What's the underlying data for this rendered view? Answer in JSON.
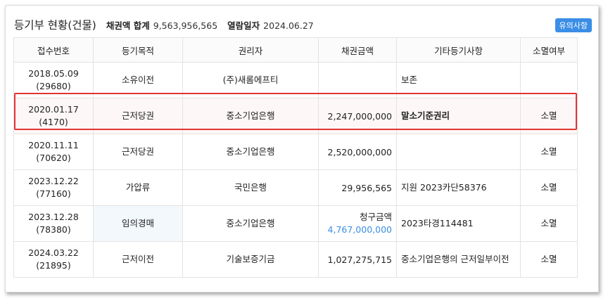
{
  "header": {
    "title": "등기부 현황(건물)",
    "total_label": "채권액 합계",
    "total_value": "9,563,956,565",
    "date_label": "열람일자",
    "date_value": "2024.06.27",
    "notice_button": "유의사항"
  },
  "table": {
    "columns": [
      "접수번호",
      "등기목적",
      "권리자",
      "채권금액",
      "기타등기사항",
      "소멸여부"
    ],
    "rows": [
      {
        "date": "2018.05.09",
        "no": "(29680)",
        "purpose": "소유이전",
        "holder": "(주)새롬에프티",
        "amount": "",
        "amount_label": "",
        "etc": "보존",
        "extinct": ""
      },
      {
        "date": "2020.01.17",
        "no": "(4170)",
        "purpose": "근저당권",
        "holder": "중소기업은행",
        "amount": "2,247,000,000",
        "amount_label": "",
        "etc": "말소기준권리",
        "extinct": "소멸"
      },
      {
        "date": "2020.11.11",
        "no": "(70620)",
        "purpose": "근저당권",
        "holder": "중소기업은행",
        "amount": "2,520,000,000",
        "amount_label": "",
        "etc": "",
        "extinct": "소멸"
      },
      {
        "date": "2023.12.22",
        "no": "(77160)",
        "purpose": "가압류",
        "holder": "국민은행",
        "amount": "29,956,565",
        "amount_label": "",
        "etc": "지원 2023카단58376",
        "extinct": "소멸"
      },
      {
        "date": "2023.12.28",
        "no": "(78380)",
        "purpose": "임의경매",
        "holder": "중소기업은행",
        "amount": "4,767,000,000",
        "amount_label": "청구금액",
        "etc": "2023타경114481",
        "extinct": "소멸"
      },
      {
        "date": "2024.03.22",
        "no": "(21895)",
        "purpose": "근저이전",
        "holder": "기술보증기금",
        "amount": "1,027,275,715",
        "amount_label": "",
        "etc": "중소기업은행의 근저일부이전",
        "extinct": "소멸"
      }
    ]
  },
  "colors": {
    "accent": "#3a8ee6",
    "highlight_border": "#e23434"
  }
}
